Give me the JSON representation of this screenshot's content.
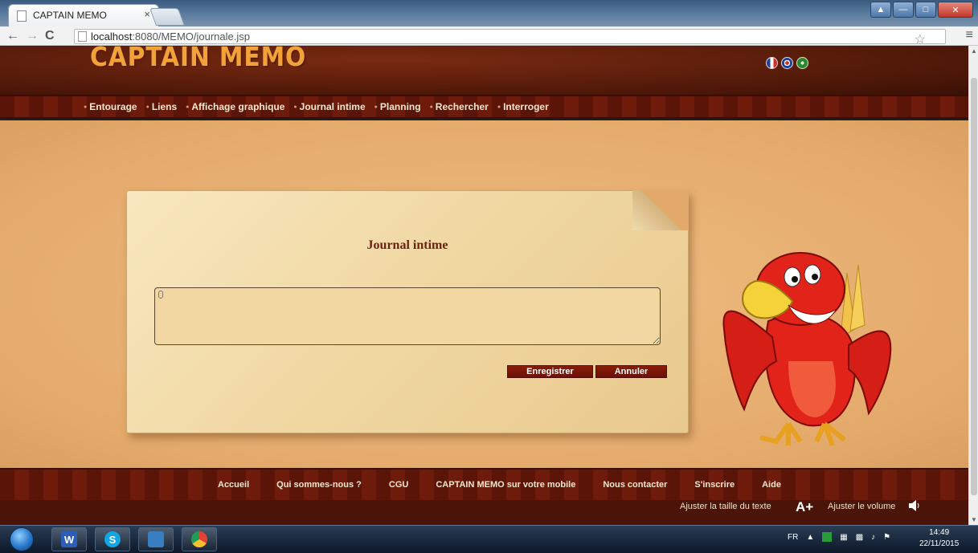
{
  "browser": {
    "tab_title": "CAPTAIN MEMO",
    "tab_close": "×",
    "url_host": "localhost",
    "url_rest": ":8080/MEMO/journale.jsp"
  },
  "header": {
    "logo": "CAPTAIN MEMO",
    "flags": [
      "french-flag-icon",
      "uk-flag-icon",
      "arabic-flag-icon"
    ]
  },
  "nav": {
    "items": [
      {
        "label": "Entourage"
      },
      {
        "label": "Liens"
      },
      {
        "label": "Affichage graphique"
      },
      {
        "label": "Journal intime"
      },
      {
        "label": "Planning"
      },
      {
        "label": "Rechercher"
      },
      {
        "label": "Interroger"
      }
    ]
  },
  "journal": {
    "title": "Journal intime",
    "text_value": "",
    "save_label": "Enregistrer",
    "cancel_label": "Annuler"
  },
  "footer": {
    "links": [
      {
        "label": "Accueil"
      },
      {
        "label": "Qui sommes-nous ?"
      },
      {
        "label": "CGU"
      },
      {
        "label": "CAPTAIN MEMO sur votre mobile"
      },
      {
        "label": "Nous contacter"
      },
      {
        "label": "S'inscrire"
      },
      {
        "label": "Aide"
      }
    ],
    "adjust_text": "Ajuster la taille du texte",
    "aplus": "A+",
    "adjust_volume": "Ajuster le volume"
  },
  "taskbar": {
    "language": "FR",
    "time": "14:49",
    "date": "22/11/2015"
  },
  "colors": {
    "accent": "#6b1608",
    "logo": "#f3a23a",
    "parchment": "#f0d7a2"
  }
}
